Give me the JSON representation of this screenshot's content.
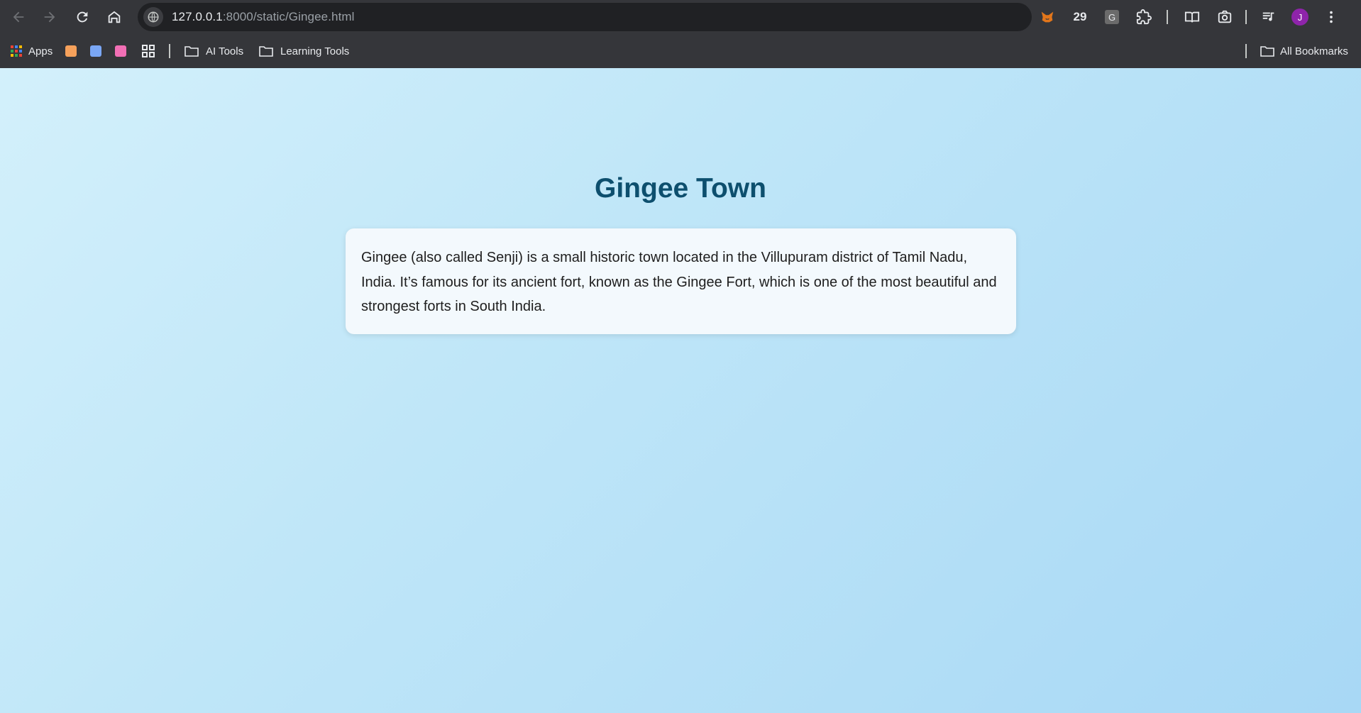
{
  "browser": {
    "url_host": "127.0.0.1",
    "url_rest": ":8000/static/Gingee.html",
    "extension_count": "29",
    "profile_initial": "J",
    "extension_g_label": "G"
  },
  "bookmarks": {
    "apps_label": "Apps",
    "folders": [
      {
        "label": "AI Tools"
      },
      {
        "label": "Learning Tools"
      }
    ],
    "all_bookmarks_label": "All Bookmarks"
  },
  "page": {
    "title": "Gingee Town",
    "paragraph": "Gingee (also called Senji) is a small historic town located in the Villupuram district of Tamil Nadu, India. It’s famous for its ancient fort, known as the Gingee Fort, which is one of the most beautiful and strongest forts in South India."
  },
  "colors": {
    "chrome_bg": "#35363a",
    "omnibox_bg": "#202124",
    "title_color": "#0d4f6e",
    "page_gradient_start": "#d3f0fb",
    "page_gradient_end": "#a8d8f5",
    "card_bg": "#f3f9fd",
    "profile_avatar": "#8e24aa"
  }
}
